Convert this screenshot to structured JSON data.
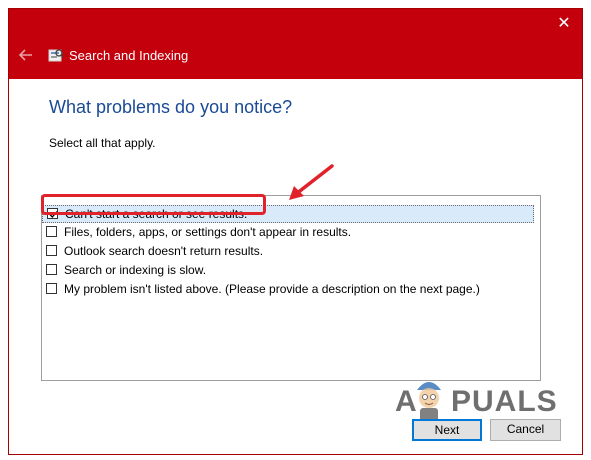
{
  "window": {
    "title": "Search and Indexing",
    "close_glyph": "✕",
    "back_icon": "back-arrow-icon",
    "app_icon": "search-indexing-icon"
  },
  "main": {
    "heading": "What problems do you notice?",
    "instruction": "Select all that apply."
  },
  "options": [
    {
      "label": "Can't start a search or see results.",
      "checked": true,
      "selected": true
    },
    {
      "label": "Files, folders, apps, or settings don't appear in results.",
      "checked": false
    },
    {
      "label": "Outlook search doesn't return results.",
      "checked": false
    },
    {
      "label": "Search or indexing is slow.",
      "checked": false
    },
    {
      "label": "My problem isn't listed above. (Please provide a description on the next page.)",
      "checked": false
    }
  ],
  "buttons": {
    "next": "Next",
    "cancel": "Cancel"
  },
  "watermark": {
    "left": "A",
    "right": "PUALS"
  },
  "colors": {
    "titlebar": "#c3000b",
    "heading": "#1a4a96",
    "annotation": "#e0222b"
  }
}
